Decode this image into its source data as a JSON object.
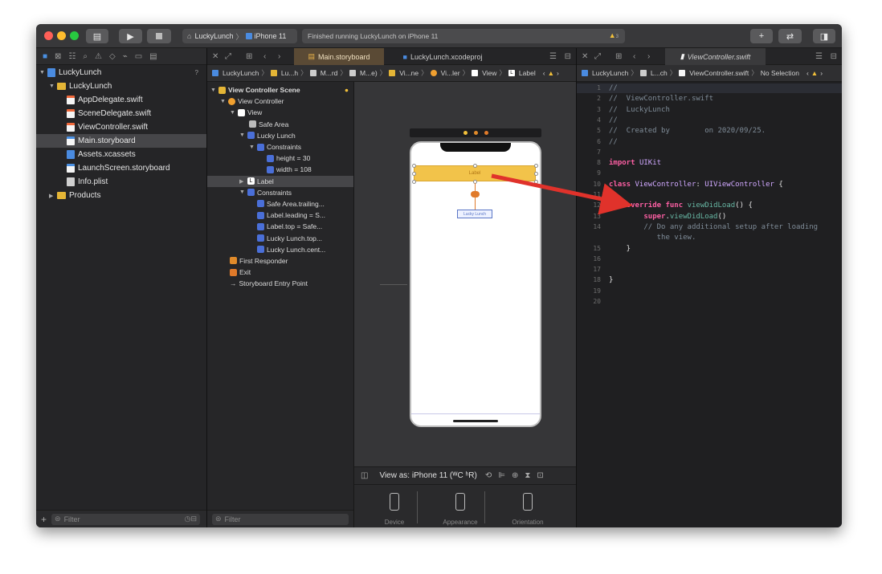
{
  "toolbar": {
    "scheme_project": "LuckyLunch",
    "scheme_device": "iPhone 11",
    "status_text": "Finished running LuckyLunch on iPhone 11",
    "warning_count": "3",
    "colors": {
      "close": "#ff5f57",
      "minimize": "#febc2e",
      "zoom": "#28c840"
    }
  },
  "navigator": {
    "project": "LuckyLunch",
    "project_badge": "?",
    "files": [
      {
        "name": "LuckyLunch",
        "kind": "folder"
      },
      {
        "name": "AppDelegate.swift",
        "kind": "swift"
      },
      {
        "name": "SceneDelegate.swift",
        "kind": "swift"
      },
      {
        "name": "ViewController.swift",
        "kind": "swift"
      },
      {
        "name": "Main.storyboard",
        "kind": "storyboard",
        "selected": true
      },
      {
        "name": "Assets.xcassets",
        "kind": "assets"
      },
      {
        "name": "LaunchScreen.storyboard",
        "kind": "storyboard"
      },
      {
        "name": "Info.plist",
        "kind": "plist"
      },
      {
        "name": "Products",
        "kind": "folder"
      }
    ],
    "filter_placeholder": "Filter"
  },
  "storyboard_editor": {
    "tabs": [
      "Main.storyboard",
      "LuckyLunch.xcodeproj"
    ],
    "breadcrumb": [
      "LuckyLunch",
      "Lu...h",
      "M...rd",
      "M...e)",
      "Vi...ne",
      "Vi...ler",
      "View",
      "Label"
    ],
    "outline": [
      "View Controller Scene",
      "View Controller",
      "View",
      "Safe Area",
      "Lucky Lunch",
      "Constraints",
      "height = 30",
      "width = 108",
      "Label",
      "Constraints",
      "Safe Area.trailing...",
      "Label.leading = S...",
      "Label.top = Safe...",
      "Lucky Lunch.top...",
      "Lucky Lunch.cent...",
      "First Responder",
      "Exit",
      "Storyboard Entry Point"
    ],
    "canvas": {
      "label_text": "Label",
      "lucky_lunch_text": "Lucky Lunch"
    },
    "view_as": "View as: iPhone 11 (ᵂC ʰR)",
    "options": [
      "Device",
      "Appearance",
      "Orientation"
    ],
    "filter_placeholder": "Filter"
  },
  "code_editor": {
    "tab": "ViewController.swift",
    "breadcrumb": [
      "LuckyLunch",
      "L...ch",
      "ViewController.swift",
      "No Selection"
    ],
    "lines": [
      "//",
      "//  ViewController.swift",
      "//  LuckyLunch",
      "//",
      "//  Created by        on 2020/09/25.",
      "//",
      "",
      "import UIKit",
      "",
      "class ViewController: UIViewController {",
      "",
      "    override func viewDidLoad() {",
      "        super.viewDidLoad()",
      "        // Do any additional setup after loading",
      "           the view.",
      "    }",
      "",
      "",
      "}",
      "",
      ""
    ],
    "line_numbers": [
      "1",
      "2",
      "3",
      "4",
      "5",
      "6",
      "7",
      "8",
      "9",
      "10",
      "11",
      "12",
      "13",
      "14",
      "",
      "15",
      "16",
      "17",
      "18",
      "19",
      "20"
    ]
  }
}
